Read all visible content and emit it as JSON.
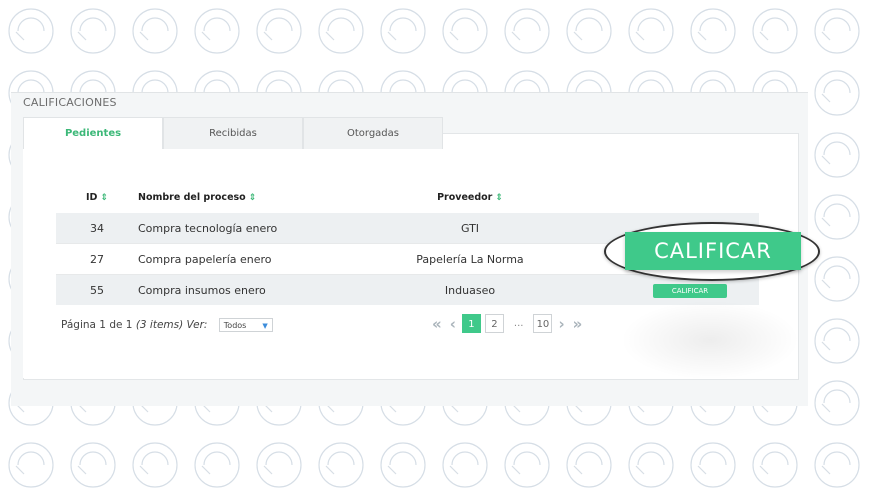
{
  "panel": {
    "title": "CALIFICACIONES"
  },
  "tabs": [
    {
      "label": "Pedientes",
      "active": true
    },
    {
      "label": "Recibidas",
      "active": false
    },
    {
      "label": "Otorgadas",
      "active": false
    }
  ],
  "table": {
    "headers": {
      "id": "ID",
      "name": "Nombre del proceso",
      "provider": "Proveedor"
    },
    "rows": [
      {
        "id": "34",
        "name": "Compra tecnología enero",
        "provider": "GTI",
        "action": ""
      },
      {
        "id": "27",
        "name": "Compra papelería enero",
        "provider": "Papelería La Norma",
        "action": ""
      },
      {
        "id": "55",
        "name": "Compra insumos enero",
        "provider": "Induaseo",
        "action": "CALIFICAR"
      }
    ]
  },
  "pager": {
    "page_text": "Página 1 de 1",
    "items_text": "(3 items) Ver:",
    "select_value": "Todos",
    "pages": [
      "1",
      "2",
      "...",
      "10"
    ]
  },
  "highlight_button": "CALIFICAR",
  "colors": {
    "accent": "#3fc98a",
    "tab_active": "#3cb878"
  }
}
